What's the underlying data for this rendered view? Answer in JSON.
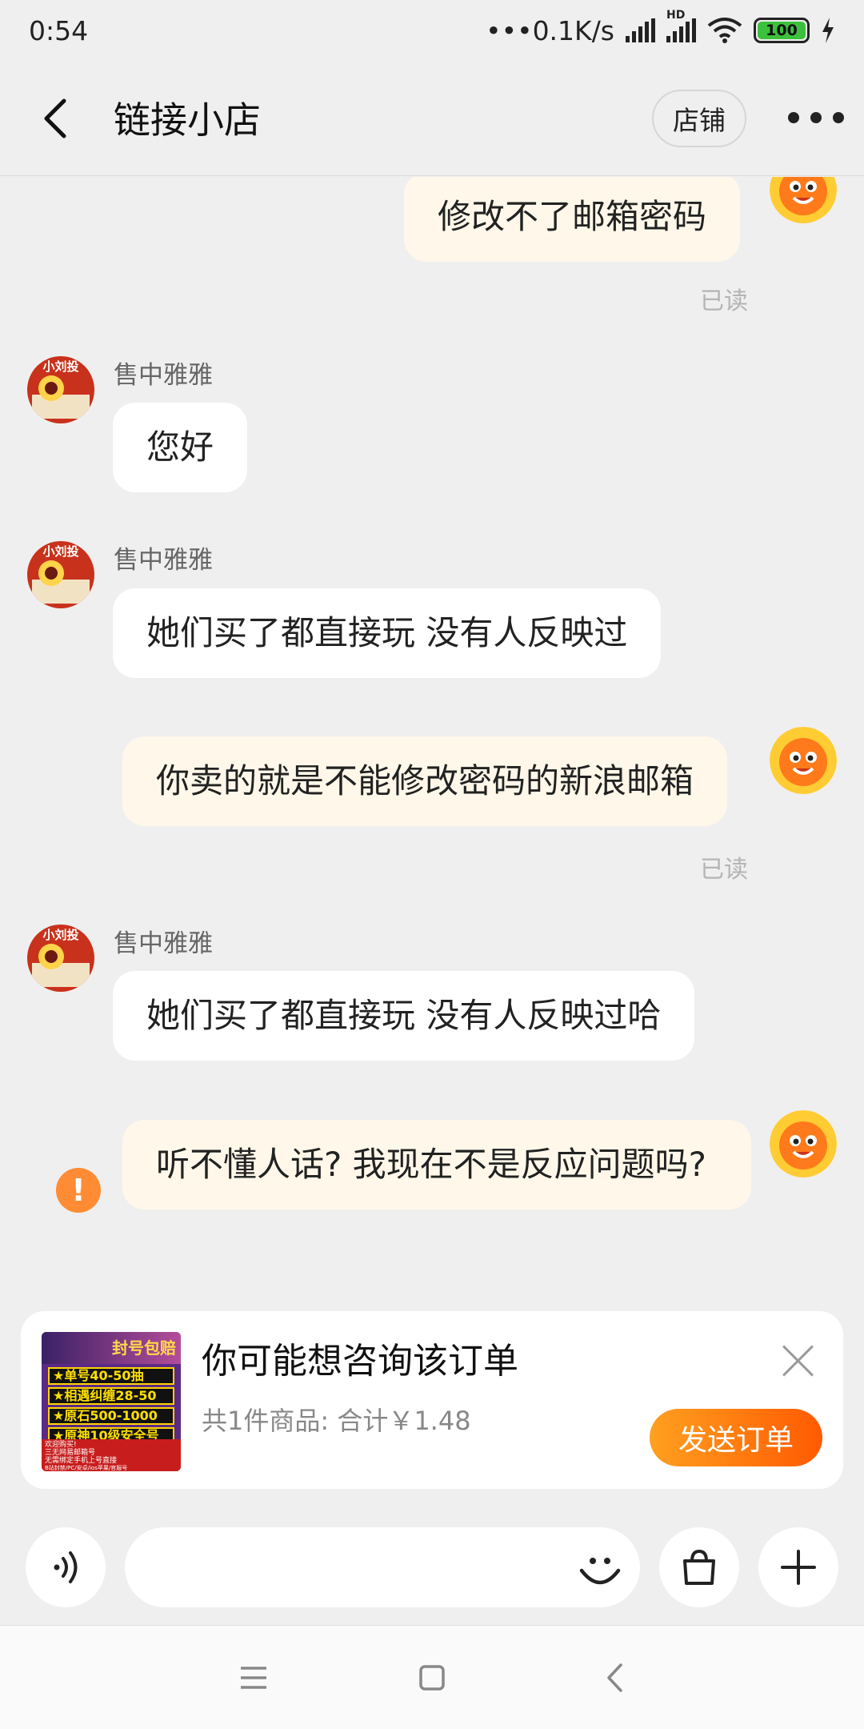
{
  "status_bar": {
    "time": "0:54",
    "network_speed": "•••0.1K/s",
    "hd_label": "HD",
    "battery": "100"
  },
  "header": {
    "title": "链接小店",
    "shop_button": "店铺"
  },
  "messages": [
    {
      "side": "out",
      "text": "修改不了邮箱密码",
      "status": "已读"
    },
    {
      "side": "in",
      "sender": "售中雅雅",
      "text": "您好"
    },
    {
      "side": "in",
      "sender": "售中雅雅",
      "text": "她们买了都直接玩 没有人反映过"
    },
    {
      "side": "out",
      "text": "你卖的就是不能修改密码的新浪邮箱",
      "status": "已读"
    },
    {
      "side": "in",
      "sender": "售中雅雅",
      "text": "她们买了都直接玩 没有人反映过哈"
    },
    {
      "side": "out",
      "text": "听不懂人话? 我现在不是反应问题吗?",
      "failed": true,
      "failed_icon": "!"
    }
  ],
  "order_card": {
    "title": "你可能想咨询该订单",
    "summary": "共1件商品: 合计￥1.48",
    "send_button": "发送订单",
    "thumbnail": {
      "badge": "封号包赔",
      "rows": [
        "★单号40-50抽",
        "★相遇纠缠28-50",
        "★原石500-1000",
        "★原神10级安全号"
      ],
      "footer_lines": [
        "欢迎购买!",
        "三无网易邮箱号",
        "无需绑定手机上号直接",
        "B站封禁/PC/安卓/ios苹果/官服号"
      ]
    }
  },
  "input_bar": {
    "placeholder": ""
  },
  "colors": {
    "accent": "#ff6a00",
    "out_bubble": "#fff8ea",
    "in_bubble": "#ffffff",
    "background": "#efefef",
    "battery": "#3cc13c"
  }
}
